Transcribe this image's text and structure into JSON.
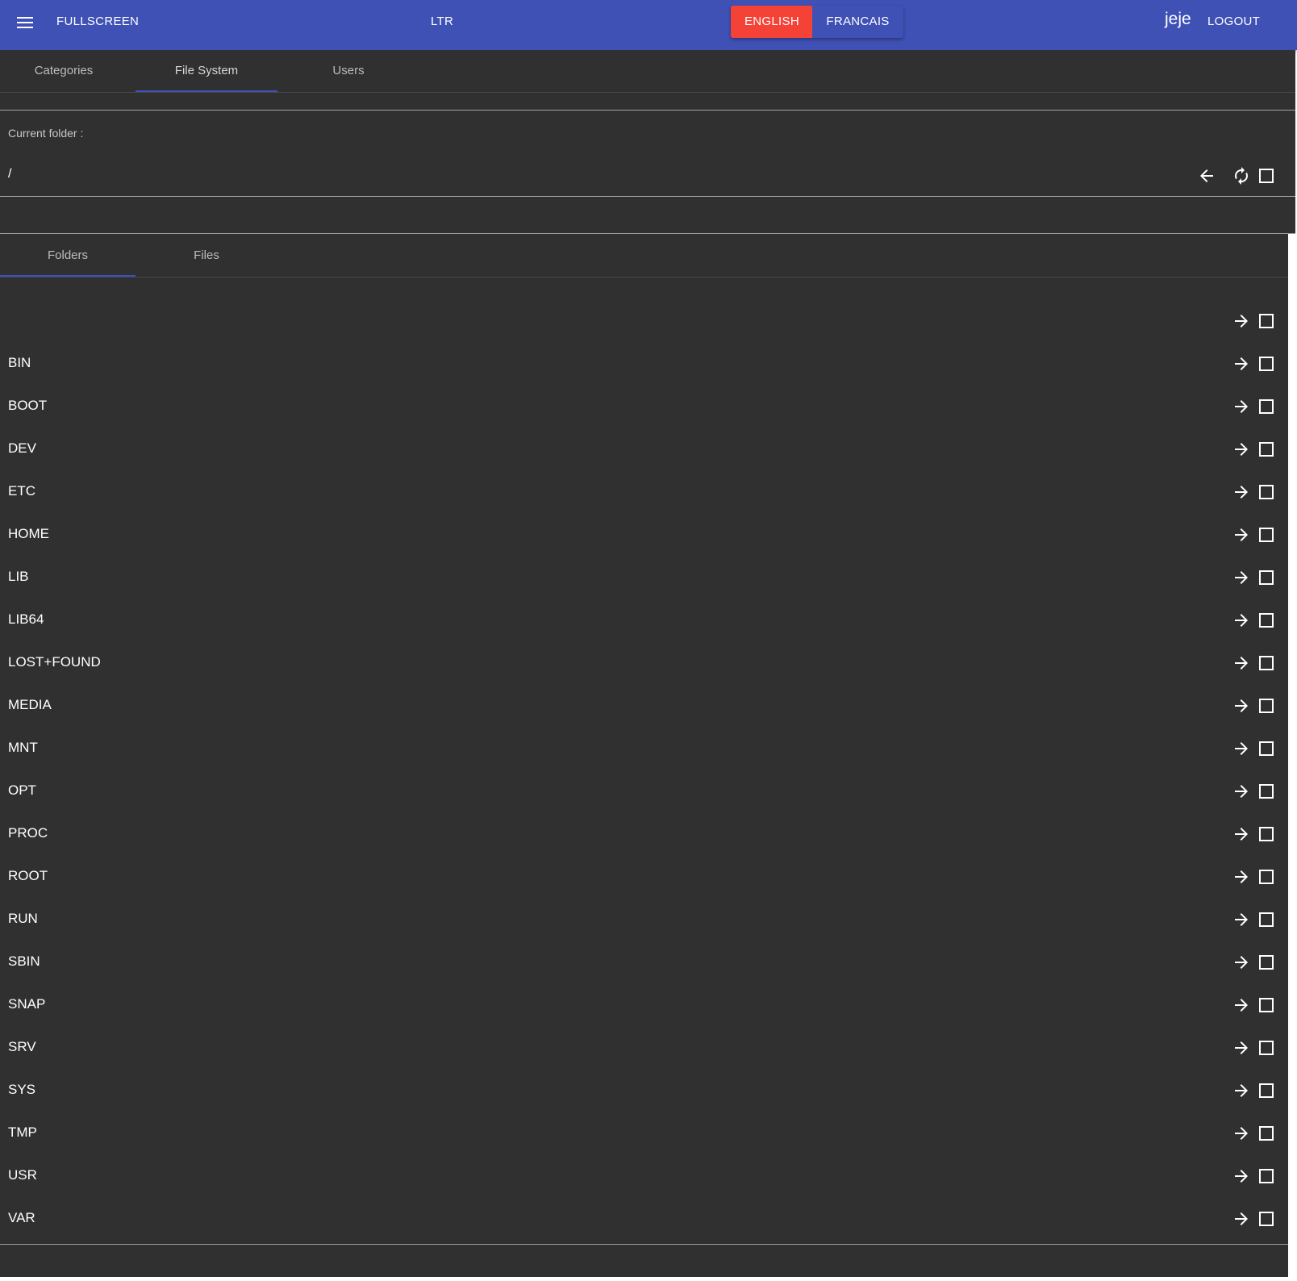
{
  "appbar": {
    "menu_icon": "menu-icon",
    "fullscreen_label": "FULLSCREEN",
    "direction_label": "LTR",
    "languages": [
      {
        "label": "ENGLISH",
        "active": true
      },
      {
        "label": "FRANCAIS",
        "active": false
      }
    ],
    "username": "jeje",
    "logout_label": "LOGOUT",
    "colors": {
      "primary": "#3f51b5",
      "accent": "#f44336"
    }
  },
  "main_tabs": [
    "Categories",
    "File System",
    "Users"
  ],
  "main_tabs_active": "File System",
  "current_folder": {
    "label": "Current folder :",
    "path": "/",
    "actions": [
      "arrow-back-icon",
      "refresh-icon",
      "checkbox-outline-icon"
    ]
  },
  "folder_tabs": [
    "Folders",
    "Files"
  ],
  "folder_tabs_active": "Folders",
  "folders": [
    "",
    "BIN",
    "BOOT",
    "DEV",
    "ETC",
    "HOME",
    "LIB",
    "LIB64",
    "LOST+FOUND",
    "MEDIA",
    "MNT",
    "OPT",
    "PROC",
    "ROOT",
    "RUN",
    "SBIN",
    "SNAP",
    "SRV",
    "SYS",
    "TMP",
    "USR",
    "VAR"
  ],
  "row_actions": [
    "arrow-forward-icon",
    "checkbox-outline-icon"
  ]
}
